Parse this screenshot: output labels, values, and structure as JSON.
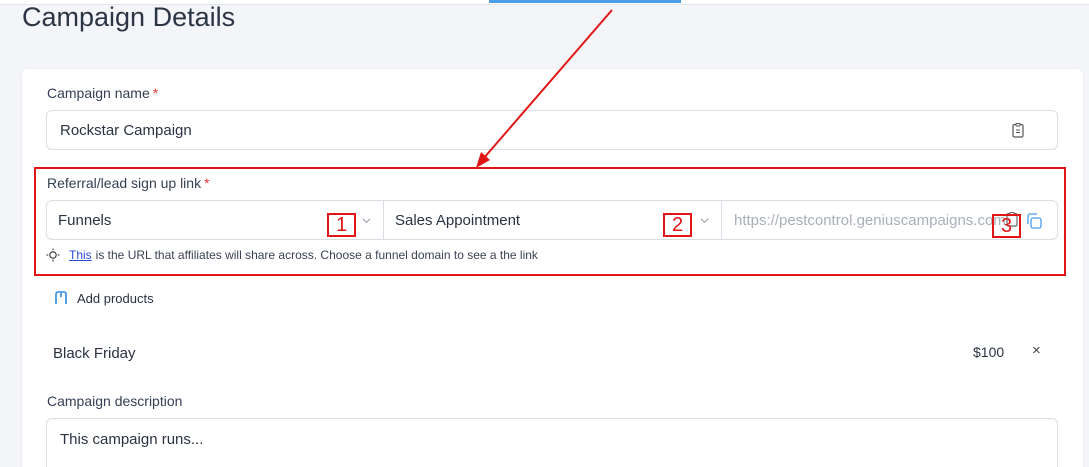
{
  "page": {
    "title": "Campaign Details"
  },
  "campaign_name": {
    "label": "Campaign name",
    "required_mark": "*",
    "value": "Rockstar Campaign"
  },
  "referral": {
    "label": "Referral/lead sign up link",
    "required_mark": "*",
    "funnel_select": "Funnels",
    "step_select": "Sales Appointment",
    "url_value": "https://pestcontrol.geniuscampaigns.com",
    "hint_link": "This",
    "hint_text": "is the URL that affiliates will share across. Choose a funnel domain to see a the link"
  },
  "annotations": {
    "box1": "1",
    "box2": "2",
    "box3": "3",
    "highlight_color": "#e11515"
  },
  "products": {
    "add_label": "Add products",
    "items": [
      {
        "name": "Black Friday",
        "price": "$100",
        "remove": "×"
      }
    ]
  },
  "description": {
    "label": "Campaign description",
    "value": "This campaign runs..."
  },
  "colors": {
    "accent": "#2d8ae0",
    "link": "#2d4bd6",
    "required": "#e5372f"
  }
}
